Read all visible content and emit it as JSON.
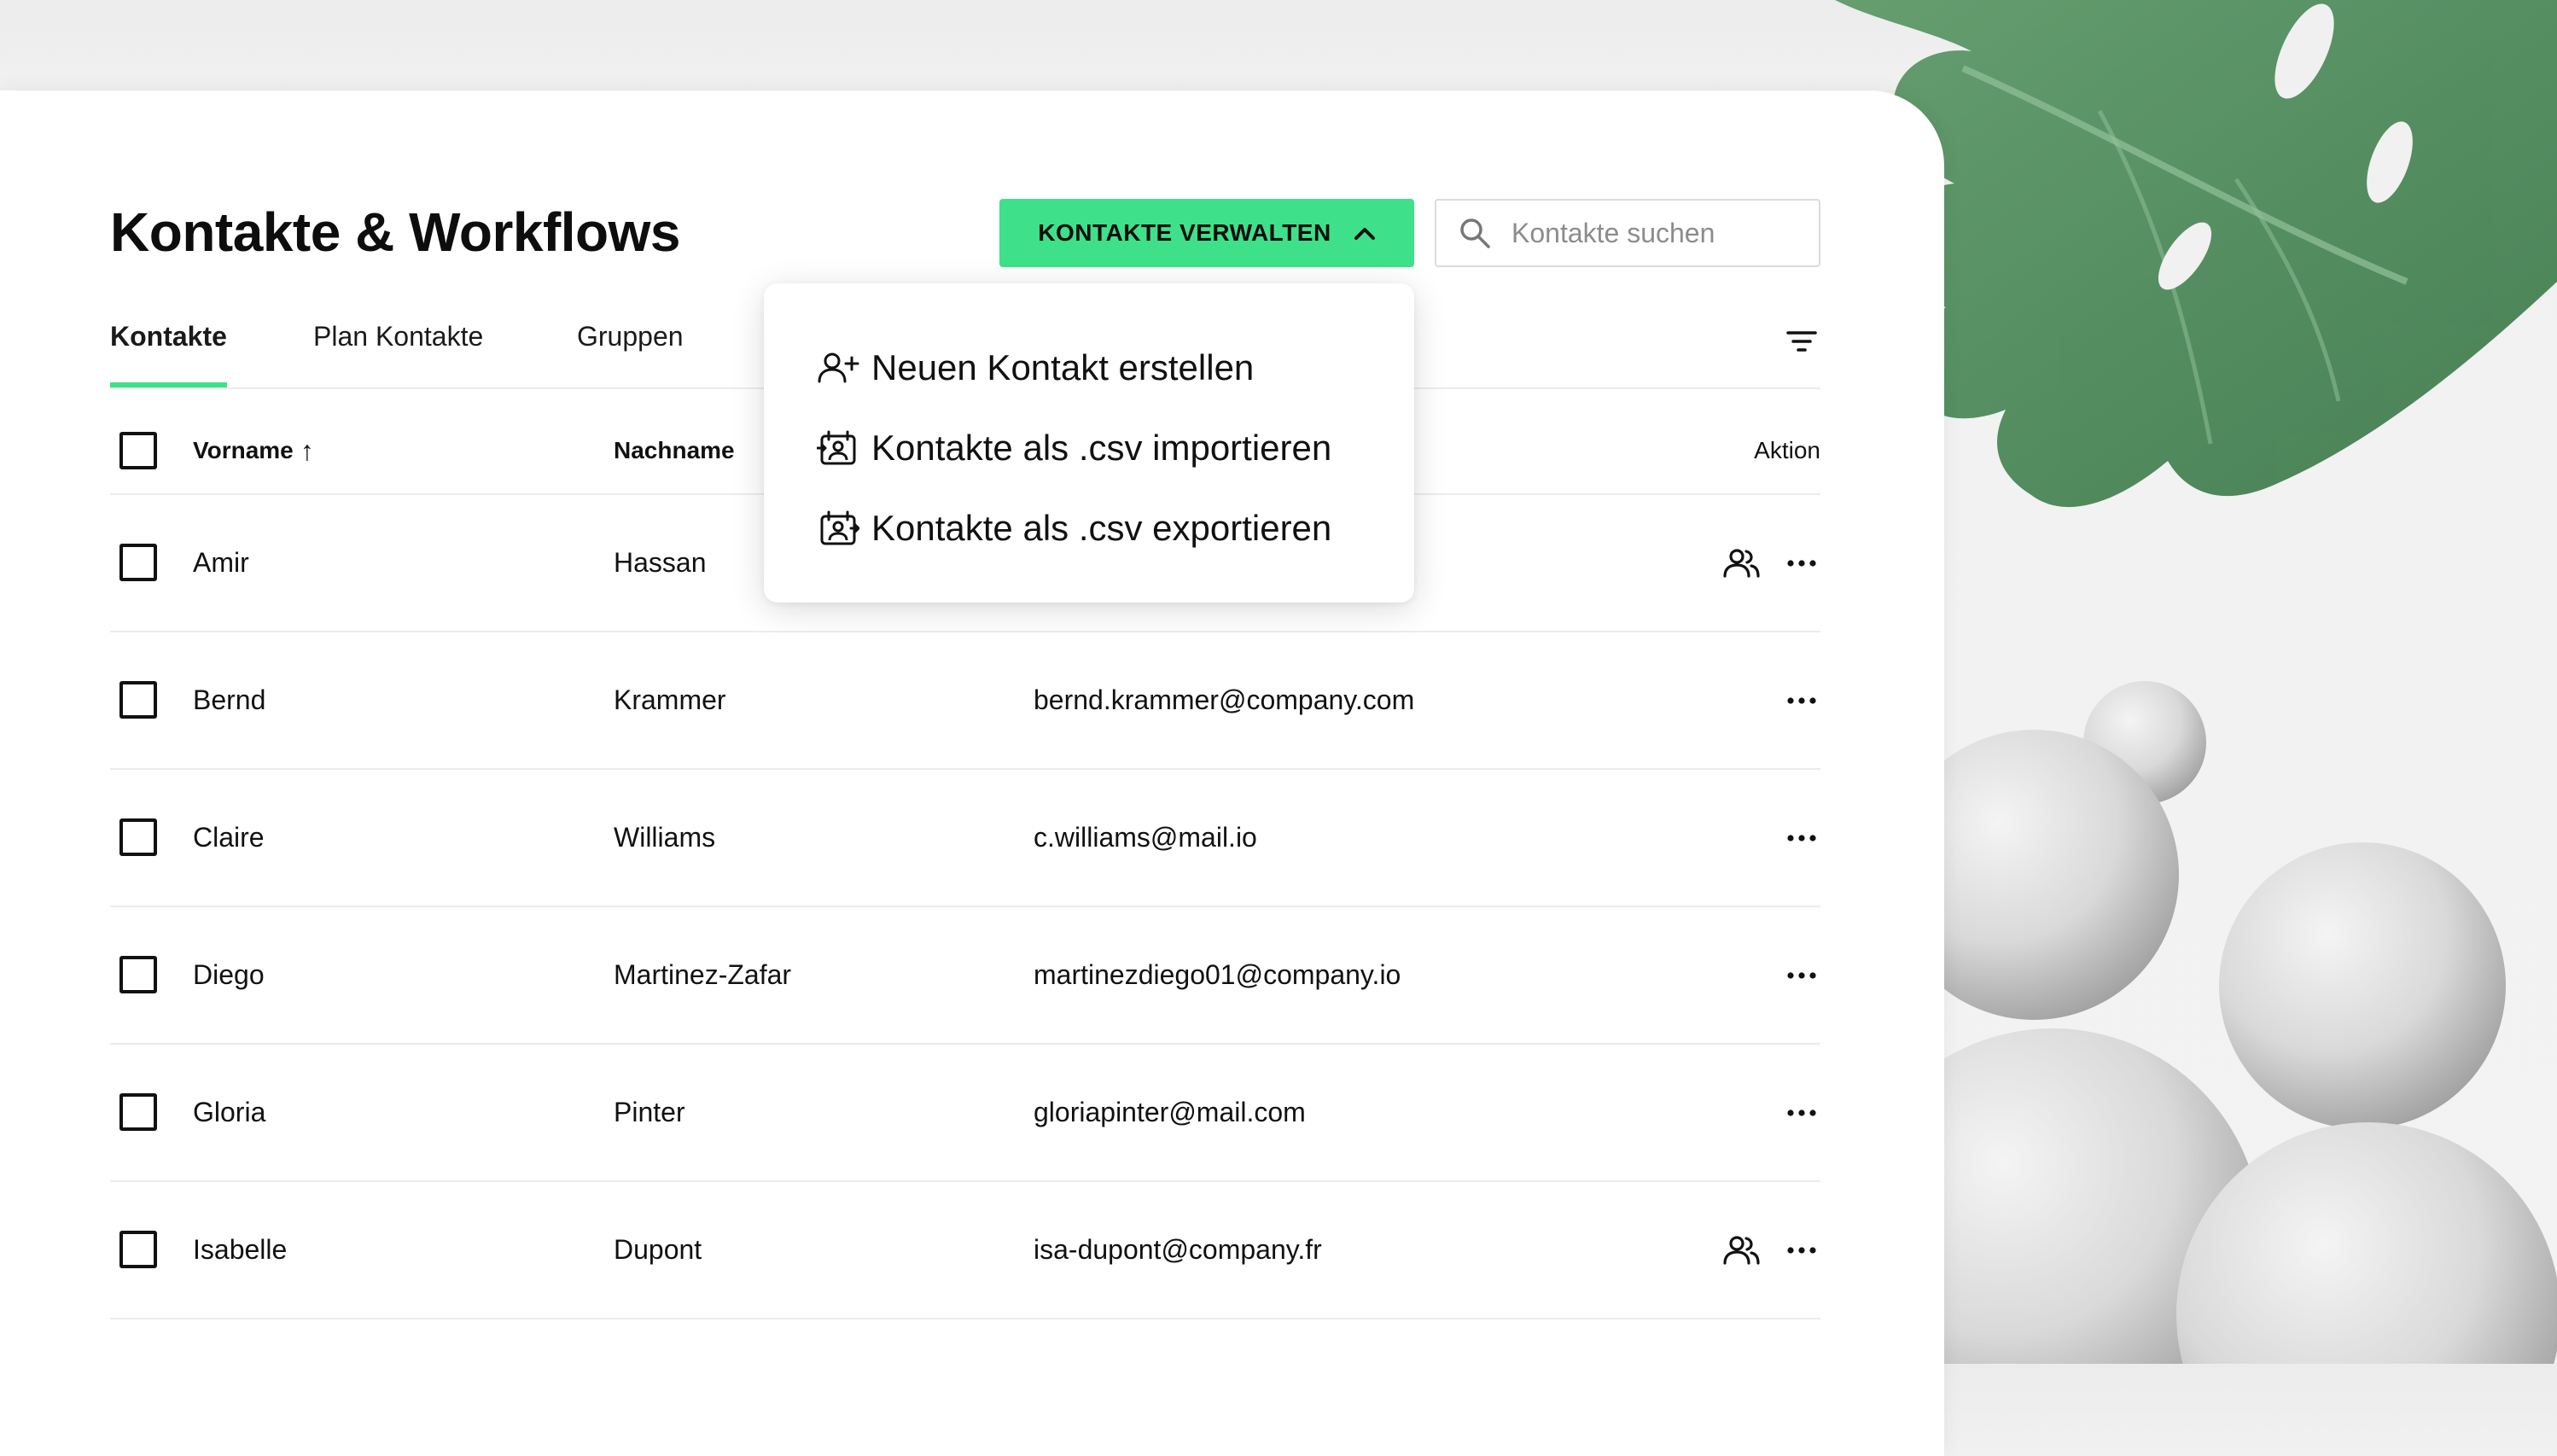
{
  "page": {
    "title": "Kontakte & Workflows"
  },
  "toolbar": {
    "manage_label": "KONTAKTE VERWALTEN",
    "search_placeholder": "Kontakte suchen",
    "search_value": ""
  },
  "tabs": [
    {
      "label": "Kontakte",
      "active": true
    },
    {
      "label": "Plan Kontakte",
      "active": false
    },
    {
      "label": "Gruppen",
      "active": false
    }
  ],
  "dropdown": {
    "items": [
      {
        "label": "Neuen Kontakt erstellen",
        "icon": "add-user-icon"
      },
      {
        "label": "Kontakte als .csv importieren",
        "icon": "import-contacts-icon"
      },
      {
        "label": "Kontakte als .csv exportieren",
        "icon": "export-contacts-icon"
      }
    ]
  },
  "table": {
    "columns": {
      "first_name": "Vorname",
      "sort_indicator": "↑",
      "last_name": "Nachname",
      "action": "Aktion"
    },
    "rows": [
      {
        "first": "Amir",
        "last": "Hassan",
        "email": "",
        "group": true
      },
      {
        "first": "Bernd",
        "last": "Krammer",
        "email": "bernd.krammer@company.com",
        "group": false
      },
      {
        "first": "Claire",
        "last": "Williams",
        "email": "c.williams@mail.io",
        "group": false
      },
      {
        "first": "Diego",
        "last": "Martinez-Zafar",
        "email": "martinezdiego01@company.io",
        "group": false
      },
      {
        "first": "Gloria",
        "last": "Pinter",
        "email": "gloriapinter@mail.com",
        "group": false
      },
      {
        "first": "Isabelle",
        "last": "Dupont",
        "email": "isa-dupont@company.fr",
        "group": true
      }
    ]
  },
  "colors": {
    "accent": "#3fe08a",
    "text": "#111111",
    "divider": "#ececec"
  }
}
